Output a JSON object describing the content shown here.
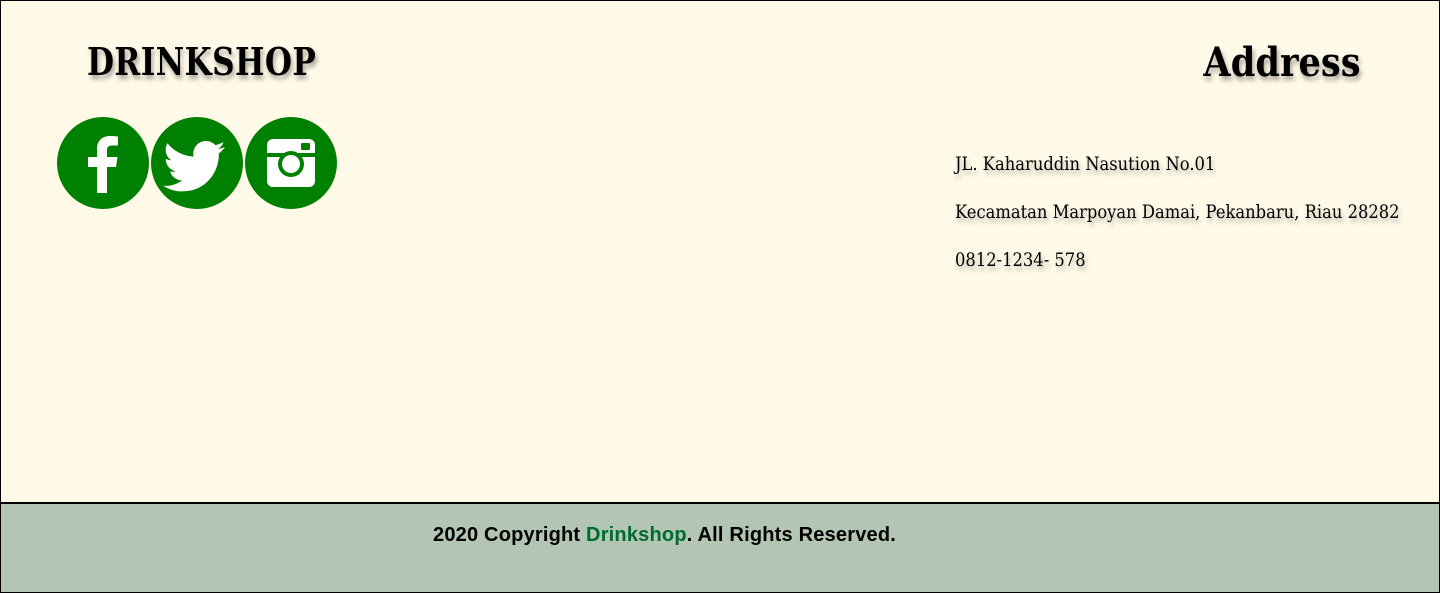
{
  "brand": {
    "title": "DRINKSHOP"
  },
  "social": {
    "items": [
      {
        "name": "facebook",
        "icon": "facebook-icon"
      },
      {
        "name": "twitter",
        "icon": "twitter-icon"
      },
      {
        "name": "instagram",
        "icon": "instagram-icon"
      }
    ],
    "color": "#008000"
  },
  "address": {
    "title": "Address",
    "lines": [
      "JL. Kaharuddin Nasution No.01",
      "Kecamatan Marpoyan Damai, Pekanbaru, Riau 28282",
      "0812-1234- 578"
    ]
  },
  "copyright": {
    "prefix": "2020 Copyright ",
    "brand": "Drinkshop",
    "suffix": ". All Rights Reserved.",
    "brand_color": "#006b2e",
    "bar_color": "#b3c6b3"
  },
  "colors": {
    "background": "#fffae8"
  }
}
